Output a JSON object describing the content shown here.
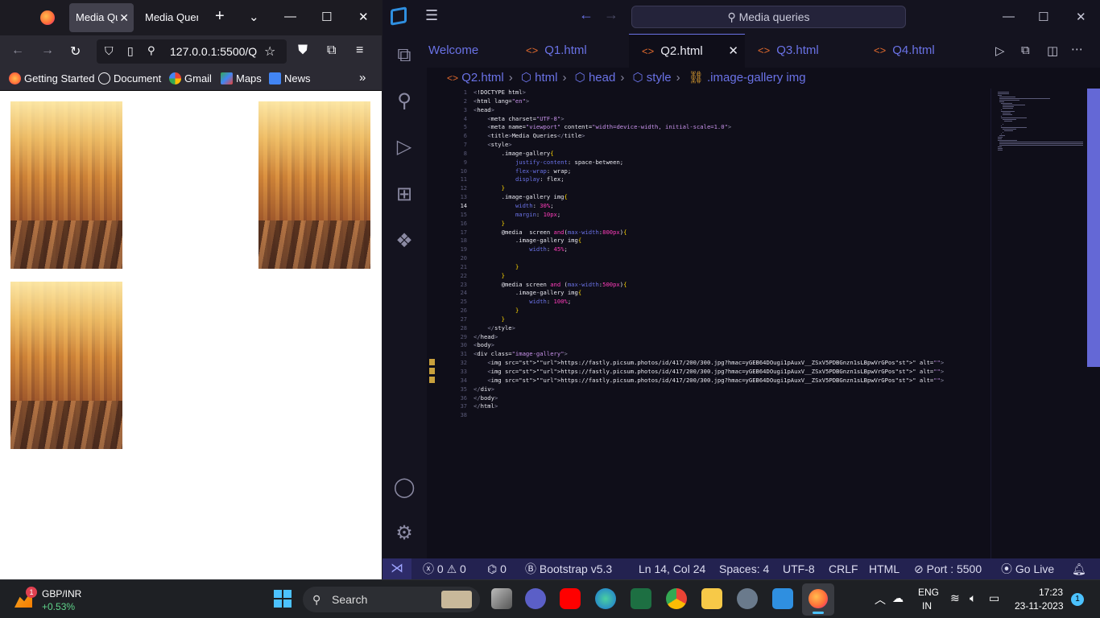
{
  "firefox": {
    "tabs": [
      {
        "title": "Media Qu"
      },
      {
        "title": "Media Queri"
      }
    ],
    "url": "127.0.0.1:5500/Q",
    "bookmarks": [
      "Getting Started",
      "Document",
      "Gmail",
      "Maps",
      "News"
    ],
    "images_count": 3
  },
  "vscode": {
    "search_label": "Media queries",
    "tabs": [
      "Welcome",
      "Q1.html",
      "Q2.html",
      "Q3.html",
      "Q4.html"
    ],
    "active_tab": "Q2.html",
    "breadcrumb": [
      "Q2.html",
      "html",
      "head",
      "style",
      ".image-gallery img"
    ],
    "line_numbers": [
      "1",
      "2",
      "3",
      "4",
      "5",
      "6",
      "7",
      "8",
      "9",
      "10",
      "11",
      "12",
      "13",
      "14",
      "15",
      "16",
      "17",
      "18",
      "19",
      "20",
      "21",
      "22",
      "23",
      "24",
      "25",
      "26",
      "27",
      "28",
      "29",
      "30",
      "31",
      "32",
      "33",
      "34",
      "35",
      "36",
      "37",
      "38"
    ],
    "current_line": "14",
    "code_lines": [
      "<!DOCTYPE html>",
      "<html lang=\"en\">",
      "<head>",
      "    <meta charset=\"UTF-8\">",
      "    <meta name=\"viewport\" content=\"width=device-width, initial-scale=1.0\">",
      "    <title>Media Queries</title>",
      "    <style>",
      "        .image-gallery{",
      "            justify-content: space-between;",
      "            flex-wrap: wrap;",
      "            display: flex;",
      "        }",
      "        .image-gallery img{",
      "            width: 30%;",
      "            margin: 10px;",
      "        }",
      "        @media  screen and(max-width:800px){",
      "            .image-gallery img{",
      "                width: 45%;",
      "",
      "            }",
      "        }",
      "        @media screen and (max-width:500px){",
      "            .image-gallery img{",
      "                width: 100%;",
      "            }",
      "        }",
      "    </style>",
      "</head>",
      "<body>",
      "<div class=\"image-gallery\">",
      "    <img src=\"https://fastly.picsum.photos/id/417/200/300.jpg?hmac=yGEB64DOugi1pAuxV__ZSxV5PDBGnzn1sLBpwVrGPos\" alt=\"\">",
      "    <img src=\"https://fastly.picsum.photos/id/417/200/300.jpg?hmac=yGEB64DOugi1pAuxV__ZSxV5PDBGnzn1sLBpwVrGPos\" alt=\"\">",
      "    <img src=\"https://fastly.picsum.photos/id/417/200/300.jpg?hmac=yGEB64DOugi1pAuxV__ZSxV5PDBGnzn1sLBpwVrGPos\" alt=\"\">",
      "</div>",
      "</body>",
      "</html>",
      ""
    ],
    "status": {
      "errors": "0",
      "warnings": "0",
      "ports": "0",
      "bootstrap": "Bootstrap v5.3",
      "position": "Ln 14, Col 24",
      "spaces": "Spaces: 4",
      "encoding": "UTF-8",
      "eol": "CRLF",
      "language": "HTML",
      "port": "Port : 5500",
      "golive": "Go Live"
    }
  },
  "taskbar": {
    "ticker": "GBP/INR",
    "ticker_change": "+0.53%",
    "ticker_badge": "1",
    "search_label": "Search",
    "lang_top": "ENG",
    "lang_bottom": "IN",
    "time": "17:23",
    "date": "23-11-2023",
    "notification_count": "1"
  }
}
